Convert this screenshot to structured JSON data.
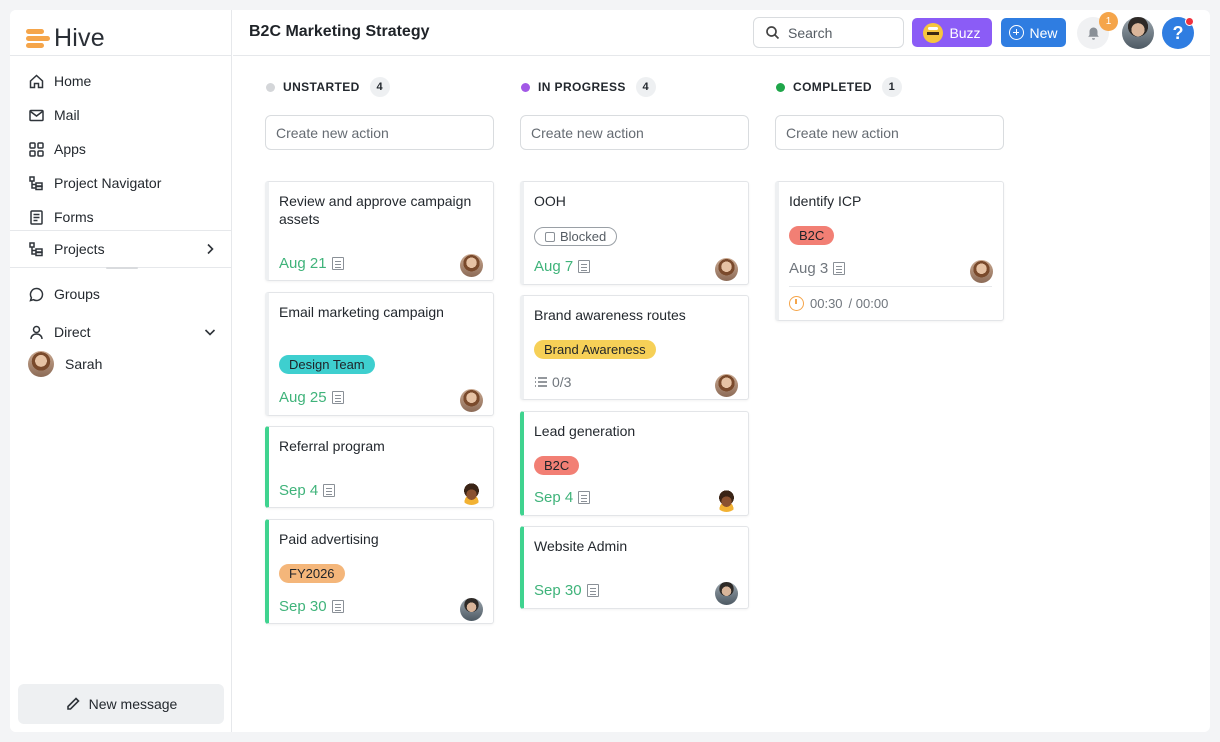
{
  "app": {
    "name": "Hive",
    "brand_color": "#f5a54a"
  },
  "sidebar": {
    "items": [
      {
        "label": "Home",
        "icon": "home-icon"
      },
      {
        "label": "Mail",
        "icon": "mail-icon"
      },
      {
        "label": "Apps",
        "icon": "apps-grid-icon"
      },
      {
        "label": "Project Navigator",
        "icon": "hierarchy-icon"
      },
      {
        "label": "Forms",
        "icon": "forms-icon"
      },
      {
        "label": "Projects",
        "icon": "hierarchy-icon"
      },
      {
        "label": "Groups",
        "icon": "chat-bubble-icon"
      },
      {
        "label": "Direct",
        "icon": "person-icon"
      }
    ],
    "direct_users": [
      {
        "name": "Sarah"
      }
    ],
    "new_message_label": "New message"
  },
  "header": {
    "title": "B2C Marketing Strategy",
    "search_placeholder": "Search",
    "buzz_label": "Buzz",
    "new_label": "New",
    "notification_count": "1",
    "help_label": "?",
    "colors": {
      "buzz": "#8b5cf6",
      "new": "#2f7de1"
    }
  },
  "board": {
    "create_placeholder": "Create new action",
    "columns": [
      {
        "name": "UNSTARTED",
        "count": "4",
        "dot_color": "#d4d6d9",
        "cards": [
          {
            "title": "Review and approve campaign assets",
            "due": "Aug 21"
          },
          {
            "title": "Email marketing campaign",
            "tag": "Design Team",
            "due": "Aug 25"
          },
          {
            "title": "Referral program",
            "due": "Sep 4"
          },
          {
            "title": "Paid advertising",
            "tag": "FY2026",
            "due": "Sep 30"
          }
        ]
      },
      {
        "name": "IN PROGRESS",
        "count": "4",
        "dot_color": "#a259e6",
        "cards": [
          {
            "title": "OOH",
            "tag": "Blocked",
            "due": "Aug 7"
          },
          {
            "title": "Brand awareness routes",
            "tag": "Brand Awareness",
            "subtasks": "0/3"
          },
          {
            "title": "Lead generation",
            "tag": "B2C",
            "due": "Sep 4"
          },
          {
            "title": "Website Admin",
            "due": "Sep 30"
          }
        ]
      },
      {
        "name": "COMPLETED",
        "count": "1",
        "dot_color": "#1fa64a",
        "cards": [
          {
            "title": "Identify ICP",
            "tag": "B2C",
            "due": "Aug 3",
            "time_tracked": "00:30",
            "time_estimate": "/ 00:00"
          }
        ]
      }
    ],
    "tag_colors": {
      "Design Team": "#3ecfcf",
      "FY2026": "#f4b67a",
      "Brand Awareness": "#f6d057",
      "B2C": "#f27f74"
    }
  }
}
